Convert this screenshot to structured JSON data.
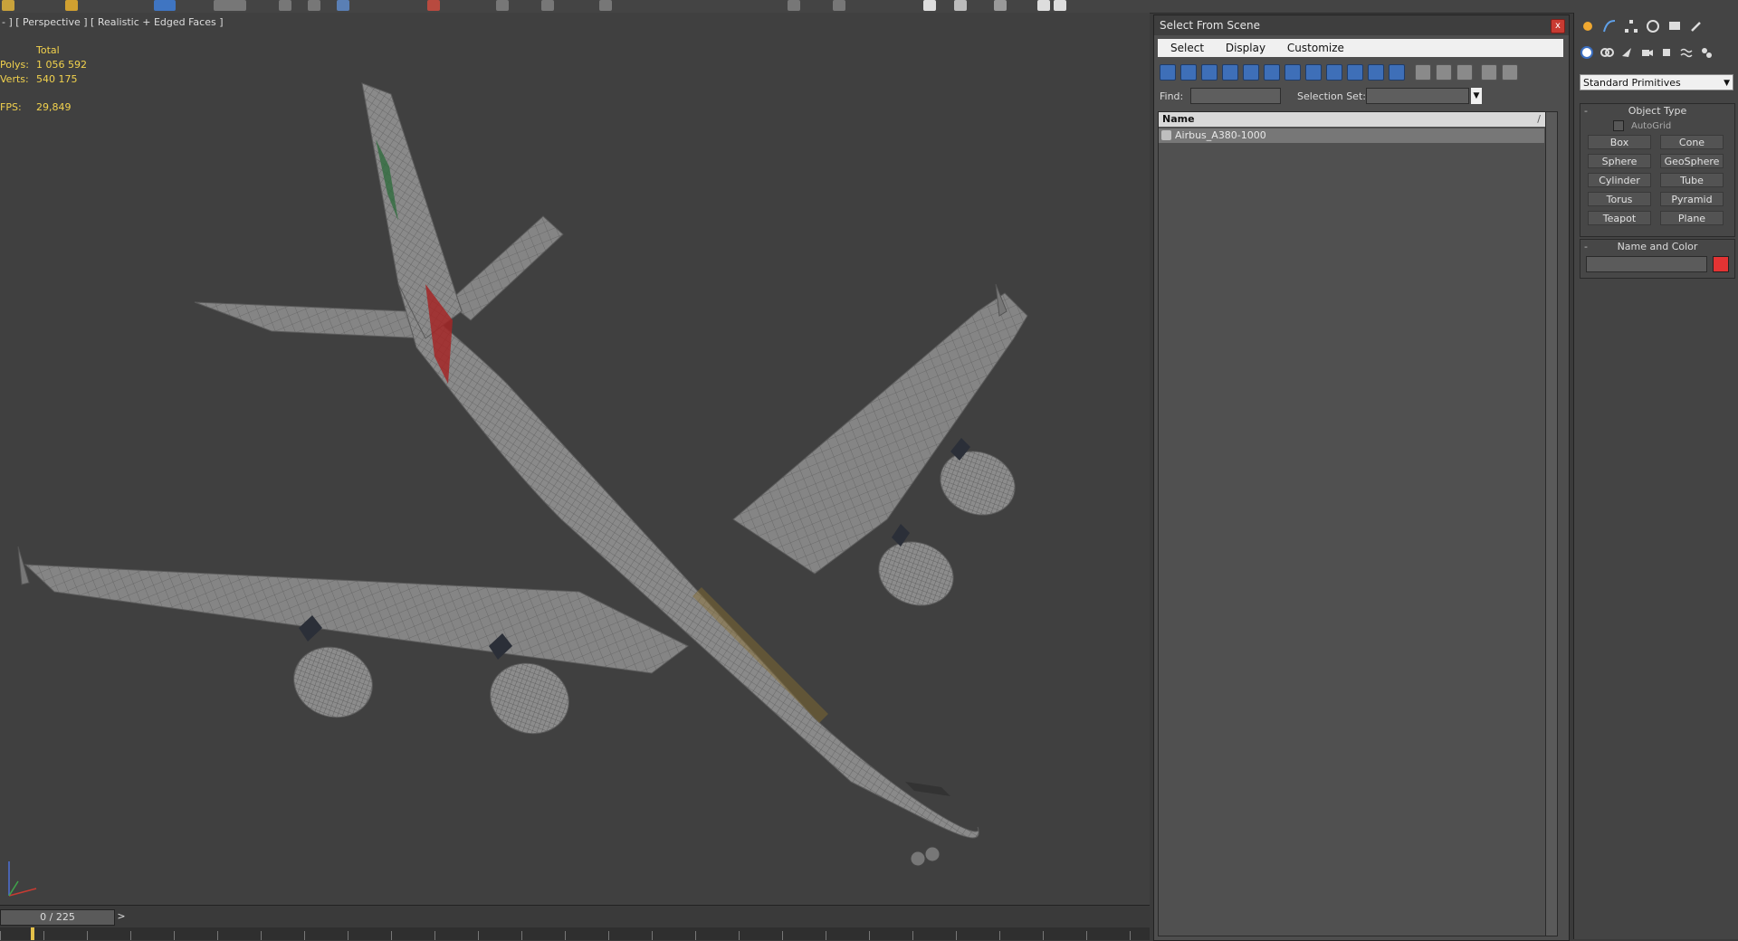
{
  "viewport": {
    "label": "- ] [ Perspective ] [ Realistic + Edged Faces ]",
    "stats": {
      "header": "Total",
      "rows": [
        {
          "key": "Polys:",
          "value": "1 056 592"
        },
        {
          "key": "Verts:",
          "value": "540 175"
        }
      ],
      "fps_key": "FPS:",
      "fps_value": "29,849"
    }
  },
  "timeline": {
    "slider_label": "0 / 225",
    "next_label": ">"
  },
  "dialog": {
    "title": "Select From Scene",
    "close_label": "x",
    "menu": [
      "Select",
      "Display",
      "Customize"
    ],
    "find_label": "Find:",
    "find_value": "",
    "selection_set_label": "Selection Set:",
    "list_header_name": "Name",
    "list_header_sort": "/",
    "rows": [
      "Airbus_A380-1000"
    ]
  },
  "command_panel": {
    "category": "Standard Primitives",
    "object_type_title": "Object Type",
    "autogrid_label": "AutoGrid",
    "buttons": [
      "Box",
      "Cone",
      "Sphere",
      "GeoSphere",
      "Cylinder",
      "Tube",
      "Torus",
      "Pyramid",
      "Teapot",
      "Plane"
    ],
    "name_color_title": "Name and Color",
    "object_color": "#e33333"
  }
}
